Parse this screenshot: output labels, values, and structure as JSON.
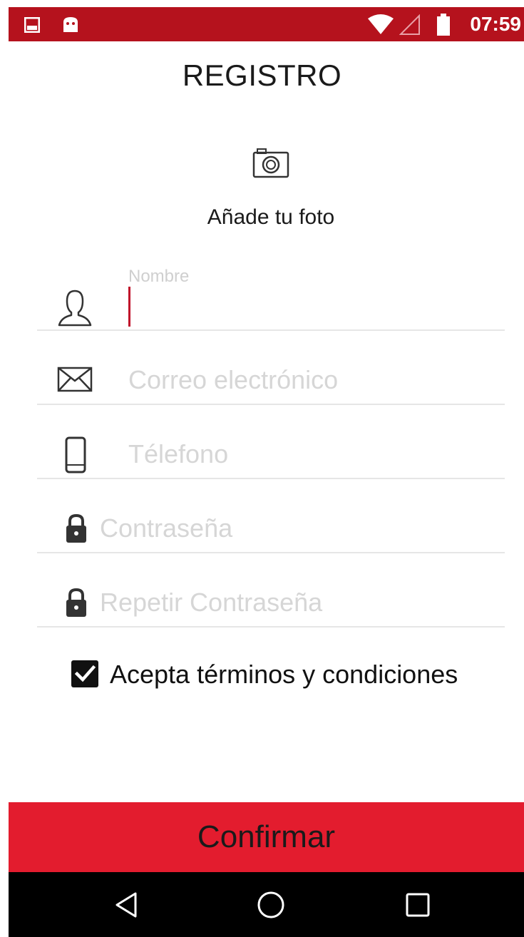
{
  "status_bar": {
    "time": "07:59",
    "background": "#b5121d"
  },
  "page": {
    "title": "REGISTRO",
    "photo_label": "Añade tu foto"
  },
  "form": {
    "name": {
      "label": "Nombre",
      "value": "",
      "icon": "user-icon"
    },
    "email": {
      "placeholder": "Correo electrónico",
      "icon": "envelope-icon"
    },
    "phone": {
      "placeholder": "Télefono",
      "icon": "phone-icon"
    },
    "password": {
      "placeholder": "Contraseña",
      "icon": "lock-icon"
    },
    "password_repeat": {
      "placeholder": "Repetir Contraseña",
      "icon": "lock-icon"
    }
  },
  "terms": {
    "label": "Acepta términos y condiciones",
    "checked": true
  },
  "confirm": {
    "label": "Confirmar",
    "color": "#e31c2e"
  },
  "nav": {
    "items": [
      "back-icon",
      "home-icon",
      "recents-icon"
    ]
  }
}
